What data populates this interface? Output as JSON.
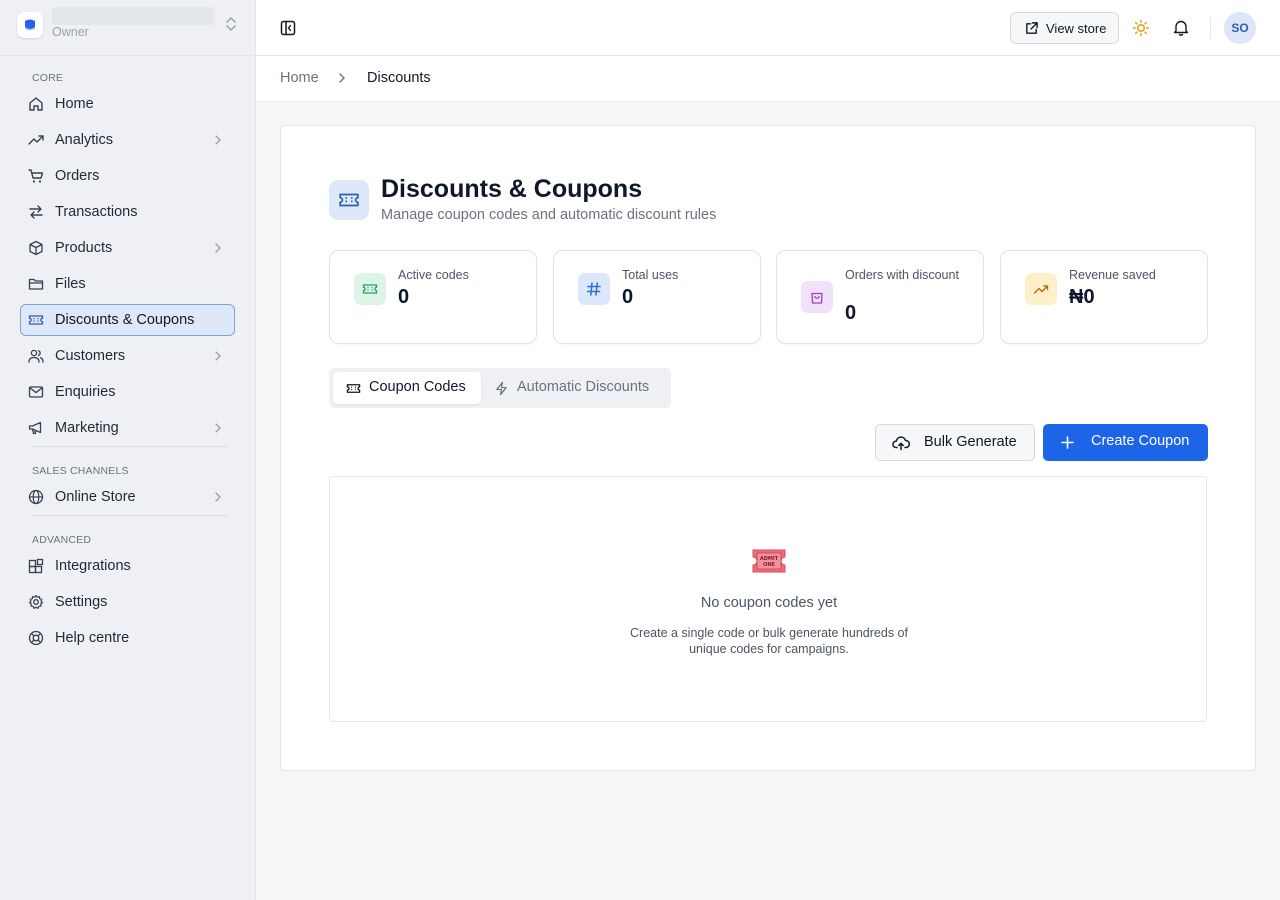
{
  "store": {
    "role": "Owner"
  },
  "sidebar": {
    "sections": [
      {
        "label": "CORE"
      },
      {
        "label": "SALES CHANNELS"
      },
      {
        "label": "ADVANCED"
      }
    ],
    "items": [
      {
        "label": "Home",
        "icon": "home-icon"
      },
      {
        "label": "Analytics",
        "icon": "trending-up-icon",
        "has_submenu": true
      },
      {
        "label": "Orders",
        "icon": "cart-icon"
      },
      {
        "label": "Transactions",
        "icon": "arrows-exchange-icon"
      },
      {
        "label": "Products",
        "icon": "box-icon",
        "has_submenu": true
      },
      {
        "label": "Files",
        "icon": "folder-icon"
      },
      {
        "label": "Discounts & Coupons",
        "icon": "ticket-icon",
        "active": true
      },
      {
        "label": "Customers",
        "icon": "users-icon",
        "has_submenu": true
      },
      {
        "label": "Enquiries",
        "icon": "mail-icon"
      },
      {
        "label": "Marketing",
        "icon": "megaphone-icon",
        "has_submenu": true
      },
      {
        "label": "Online Store",
        "icon": "globe-icon",
        "has_submenu": true
      },
      {
        "label": "Integrations",
        "icon": "blocks-icon"
      },
      {
        "label": "Settings",
        "icon": "gear-icon"
      },
      {
        "label": "Help centre",
        "icon": "lifebuoy-icon"
      }
    ]
  },
  "topbar": {
    "view_store_label": "View store",
    "avatar_initials": "SO"
  },
  "breadcrumb": {
    "home": "Home",
    "current": "Discounts"
  },
  "page": {
    "title": "Discounts & Coupons",
    "subtitle": "Manage coupon codes and automatic discount rules"
  },
  "stats": [
    {
      "label": "Active codes",
      "value": "0",
      "icon": "ticket-icon",
      "color": "#22a05a",
      "bg": "#dcf5e6"
    },
    {
      "label": "Total uses",
      "value": "0",
      "icon": "hash-icon",
      "color": "#2f6fd6",
      "bg": "#dbe7fa"
    },
    {
      "label": "Orders with discount",
      "value": "0",
      "icon": "shopping-bag-icon",
      "color": "#9b3cc9",
      "bg": "#f1e2fa"
    },
    {
      "label": "Revenue saved",
      "value": "₦0",
      "icon": "trending-up-icon",
      "color": "#b86b0c",
      "bg": "#fdf0c8"
    }
  ],
  "tabs": [
    {
      "label": "Coupon Codes",
      "active": true
    },
    {
      "label": "Automatic Discounts",
      "active": false
    }
  ],
  "actions": {
    "bulk_generate": "Bulk Generate",
    "create_coupon": "Create Coupon"
  },
  "empty_state": {
    "title": "No coupon codes yet",
    "description": "Create a single code or bulk generate hundreds of unique codes for campaigns.",
    "icon_text": "ADMIT ONE"
  },
  "colors": {
    "primary": "#1d64e8",
    "active_nav_bg": "#dde8f8",
    "active_nav_border": "#7ca3dc"
  }
}
